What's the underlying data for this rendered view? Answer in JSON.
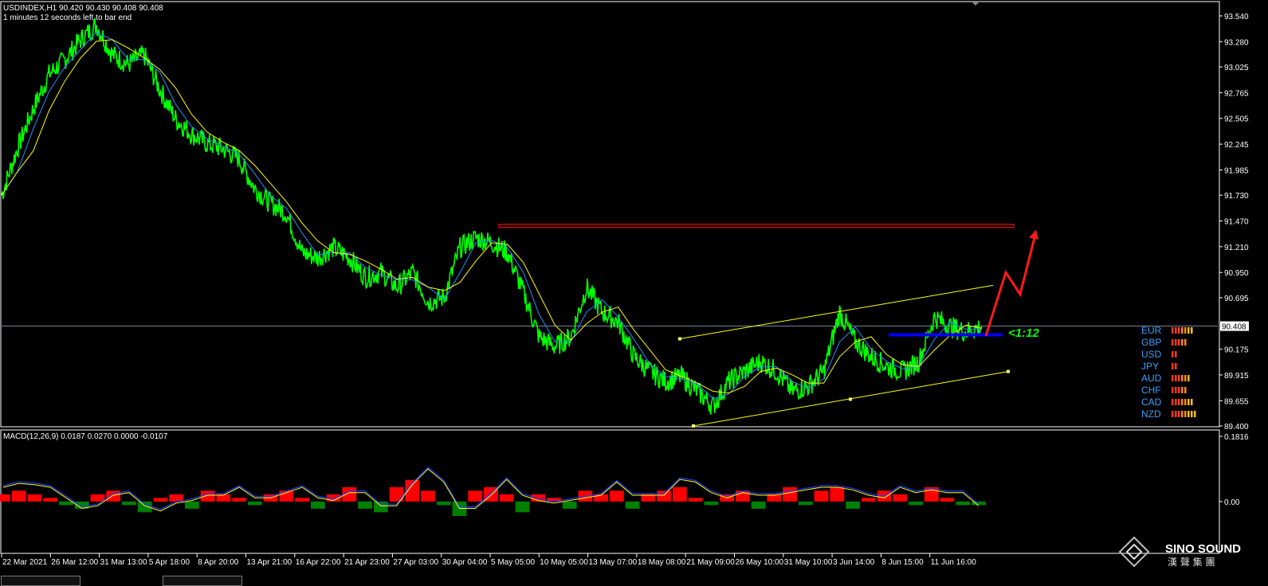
{
  "window": {
    "symbol_line": "USDINDEX,H1  90.420 90.430 90.408 90.408",
    "timer_line": "1 minutes 12 seconds left to bar end",
    "macd_line": "MACD(12,26,9) 0.0187 0.0270 0.0000 -0.0107"
  },
  "watermark": {
    "brand": "SINO SOUND",
    "chinese": "漢 聲 集 團"
  },
  "annotation": {
    "ratio": "<1:12"
  },
  "colors": {
    "price": "#00ff00",
    "ma_fast": "#1e90ff",
    "ma_slow": "#ffff00",
    "resistance": "#ff0000",
    "support": "#0000ff",
    "macd_pos": "#ff0000",
    "macd_neg": "#008000",
    "currency": "#3aa0ff",
    "axis": "#ffffff"
  },
  "currency_strength": [
    {
      "name": "EUR",
      "bars": 7
    },
    {
      "name": "GBP",
      "bars": 5
    },
    {
      "name": "USD",
      "bars": 2
    },
    {
      "name": "JPY",
      "bars": 2
    },
    {
      "name": "AUD",
      "bars": 6
    },
    {
      "name": "CHF",
      "bars": 5
    },
    {
      "name": "CAD",
      "bars": 7
    },
    {
      "name": "NZD",
      "bars": 8
    }
  ],
  "chart_data": [
    {
      "type": "line",
      "title": "USDINDEX,H1",
      "ylim": [
        89.4,
        93.58
      ],
      "y_ticks": [
        "93.540",
        "93.280",
        "93.025",
        "92.765",
        "92.505",
        "92.245",
        "91.985",
        "91.730",
        "91.470",
        "91.210",
        "90.950",
        "90.695",
        "90.408",
        "90.175",
        "89.915",
        "89.655",
        "89.400"
      ],
      "current_price": 90.408,
      "x_ticks": [
        "22 Mar 2021",
        "26 Mar 12:00",
        "31 Mar 13:00",
        "5 Apr 18:00",
        "8 Apr 20:00",
        "13 Apr 21:00",
        "16 Apr 22:00",
        "21 Apr 23:00",
        "27 Apr 03:00",
        "30 Apr 04:00",
        "5 May 05:00",
        "10 May 05:00",
        "13 May 07:00",
        "18 May 08:00",
        "21 May 09:00",
        "26 May 10:00",
        "31 May 10:00",
        "3 Jun 14:00",
        "8 Jun 15:00",
        "11 Jun 16:00"
      ],
      "series": [
        {
          "values": [
            91.73,
            92.2,
            92.6,
            92.95,
            93.1,
            93.3,
            93.45,
            93.15,
            93.05,
            93.15,
            92.8,
            92.5,
            92.35,
            92.25,
            92.2,
            92.1,
            91.8,
            91.65,
            91.55,
            91.15,
            91.1,
            91.2,
            91.1,
            90.9,
            90.95,
            90.8,
            90.95,
            90.65,
            90.7,
            91.2,
            91.3,
            91.25,
            91.15,
            90.75,
            90.3,
            90.2,
            90.3,
            90.8,
            90.55,
            90.45,
            90.1,
            89.95,
            89.85,
            89.9,
            89.75,
            89.6,
            89.85,
            89.95,
            90.05,
            89.95,
            89.75,
            89.8,
            89.95,
            90.55,
            90.25,
            90.1,
            90.0,
            89.95,
            90.05,
            90.5,
            90.4,
            90.35,
            90.408
          ]
        }
      ],
      "lines": {
        "resistance_level": 91.42,
        "breakout_support_level": 90.32,
        "channel_upper": [
          90.28,
          90.82
        ],
        "channel_lower": [
          89.4,
          89.95
        ]
      }
    },
    {
      "type": "bar",
      "title": "MACD(12,26,9)",
      "ylim": [
        -0.14,
        0.1816
      ],
      "y_ticks": [
        "0.1816",
        "0.00"
      ],
      "series": [
        {
          "values": [
            0.02,
            0.03,
            0.02,
            0.01,
            -0.01,
            -0.02,
            0.02,
            0.03,
            -0.01,
            -0.03,
            0.01,
            0.02,
            -0.02,
            0.03,
            0.02,
            0.01,
            -0.01,
            0.02,
            0.03,
            0.01,
            -0.02,
            0.02,
            0.04,
            -0.02,
            -0.03,
            0.04,
            0.06,
            0.03,
            -0.01,
            -0.04,
            0.03,
            0.04,
            0.02,
            -0.03,
            0.02,
            0.01,
            -0.02,
            0.03,
            0.02,
            0.03,
            -0.02,
            0.02,
            0.03,
            0.04,
            0.01,
            -0.01,
            0.02,
            0.03,
            -0.02,
            0.02,
            0.04,
            -0.01,
            0.03,
            0.04,
            -0.02,
            0.01,
            0.03,
            0.02,
            -0.01,
            0.04,
            0.01,
            -0.01,
            -0.01
          ]
        }
      ]
    }
  ]
}
